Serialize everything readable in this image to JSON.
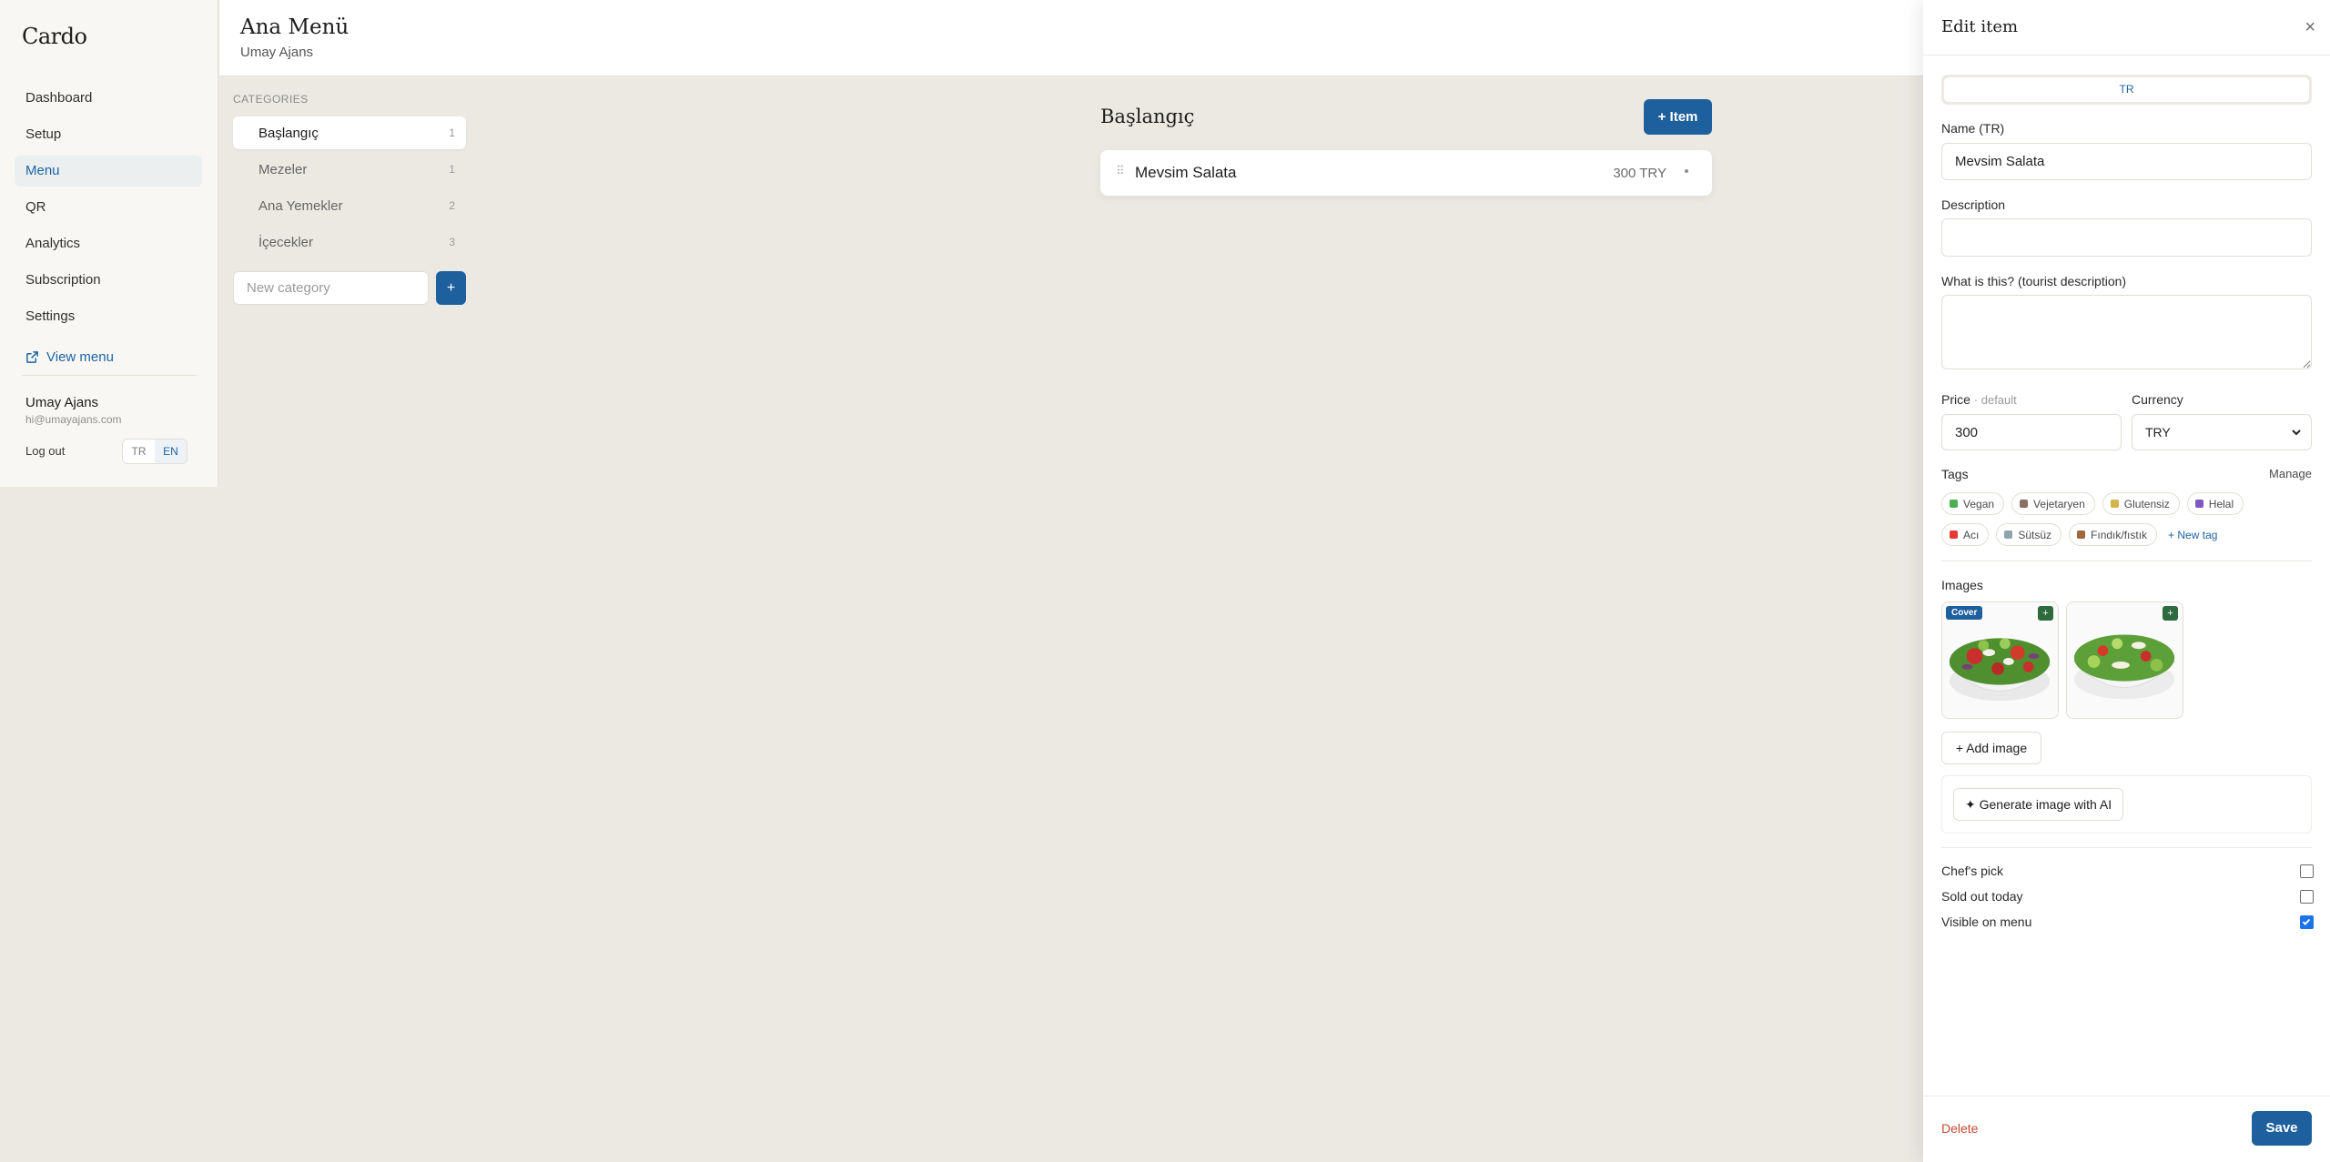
{
  "app": {
    "brand": "Cardo"
  },
  "sidebar": {
    "items": [
      {
        "label": "Dashboard"
      },
      {
        "label": "Setup"
      },
      {
        "label": "Menu",
        "active": true
      },
      {
        "label": "QR"
      },
      {
        "label": "Analytics"
      },
      {
        "label": "Subscription"
      },
      {
        "label": "Settings"
      }
    ],
    "view_menu": "View menu",
    "user": {
      "name": "Umay Ajans",
      "email": "hi@umayajans.com"
    },
    "logout": "Log out",
    "languages": [
      "TR",
      "EN"
    ],
    "active_language": "EN"
  },
  "header": {
    "title": "Ana Menü",
    "subtitle": "Umay Ajans"
  },
  "categories": {
    "heading": "CATEGORIES",
    "items": [
      {
        "label": "Başlangıç",
        "count": "1",
        "active": true
      },
      {
        "label": "Mezeler",
        "count": "1"
      },
      {
        "label": "Ana Yemekler",
        "count": "2"
      },
      {
        "label": "İçecekler",
        "count": "3"
      }
    ],
    "new_placeholder": "New category",
    "add_label": "+"
  },
  "main": {
    "section_title": "Başlangıç",
    "add_item_label": "+ Item",
    "items": [
      {
        "name": "Mevsim Salata",
        "price": "300 TRY"
      }
    ]
  },
  "drawer": {
    "title": "Edit item",
    "close": "×",
    "lang_tab": "TR",
    "name_label": "Name (TR)",
    "name_value": "Mevsim Salata",
    "description_label": "Description",
    "description_value": "",
    "tourist_label": "What is this? (tourist description)",
    "tourist_value": "",
    "price_label": "Price",
    "price_hint": "· default",
    "price_value": "300",
    "currency_label": "Currency",
    "currency_value": "TRY",
    "tags_label": "Tags",
    "manage_label": "Manage",
    "tags": [
      {
        "label": "Vegan",
        "color": "#4caf50"
      },
      {
        "label": "Vejetaryen",
        "color": "#8d6e63"
      },
      {
        "label": "Glutensiz",
        "color": "#d4b24c"
      },
      {
        "label": "Helal",
        "color": "#7e57c2"
      },
      {
        "label": "Acı",
        "color": "#e53935"
      },
      {
        "label": "Sütsüz",
        "color": "#90a4ae"
      },
      {
        "label": "Fındık/fıstık",
        "color": "#a1663a"
      }
    ],
    "new_tag_label": "+ New tag",
    "images_label": "Images",
    "cover_label": "Cover",
    "plus_badge": "+",
    "add_image_label": "+ Add image",
    "generate_label": "✦ Generate image with AI",
    "checks": [
      {
        "label": "Chef's pick",
        "checked": false
      },
      {
        "label": "Sold out today",
        "checked": false
      },
      {
        "label": "Visible on menu",
        "checked": true
      }
    ],
    "delete_label": "Delete",
    "save_label": "Save"
  },
  "colors": {
    "accent": "#1e5f9e",
    "danger": "#c8482d",
    "background": "#ebe9e2"
  }
}
